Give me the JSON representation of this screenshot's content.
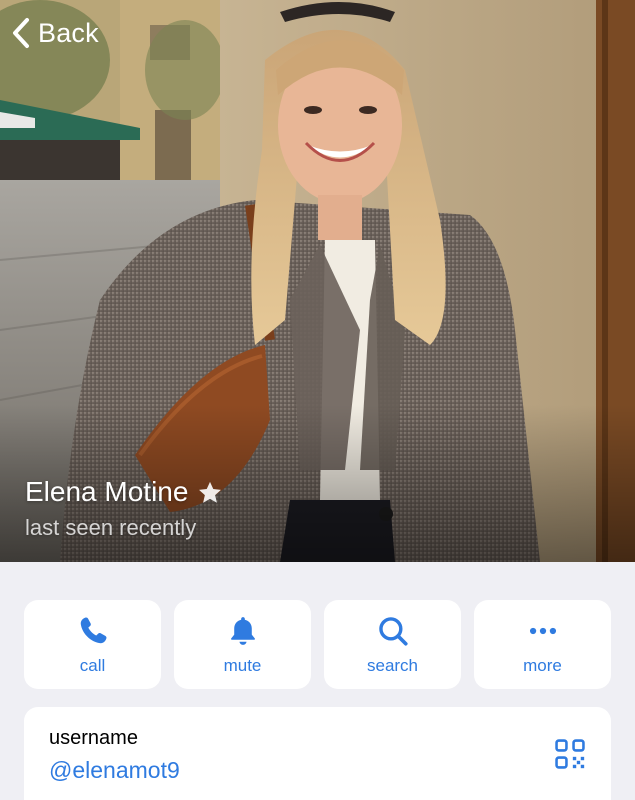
{
  "nav": {
    "back_label": "Back"
  },
  "profile": {
    "name": "Elena Motine",
    "status": "last seen recently",
    "badge_icon": "star-icon"
  },
  "actions": [
    {
      "label": "call",
      "icon": "phone-icon"
    },
    {
      "label": "mute",
      "icon": "bell-icon"
    },
    {
      "label": "search",
      "icon": "magnifier-icon"
    },
    {
      "label": "more",
      "icon": "ellipsis-icon"
    }
  ],
  "info": {
    "label": "username",
    "value": "@elenamot9",
    "qr_icon": "qr-code-icon"
  },
  "colors": {
    "accent": "#2f7be0",
    "background": "#efeff4",
    "card": "#ffffff"
  }
}
